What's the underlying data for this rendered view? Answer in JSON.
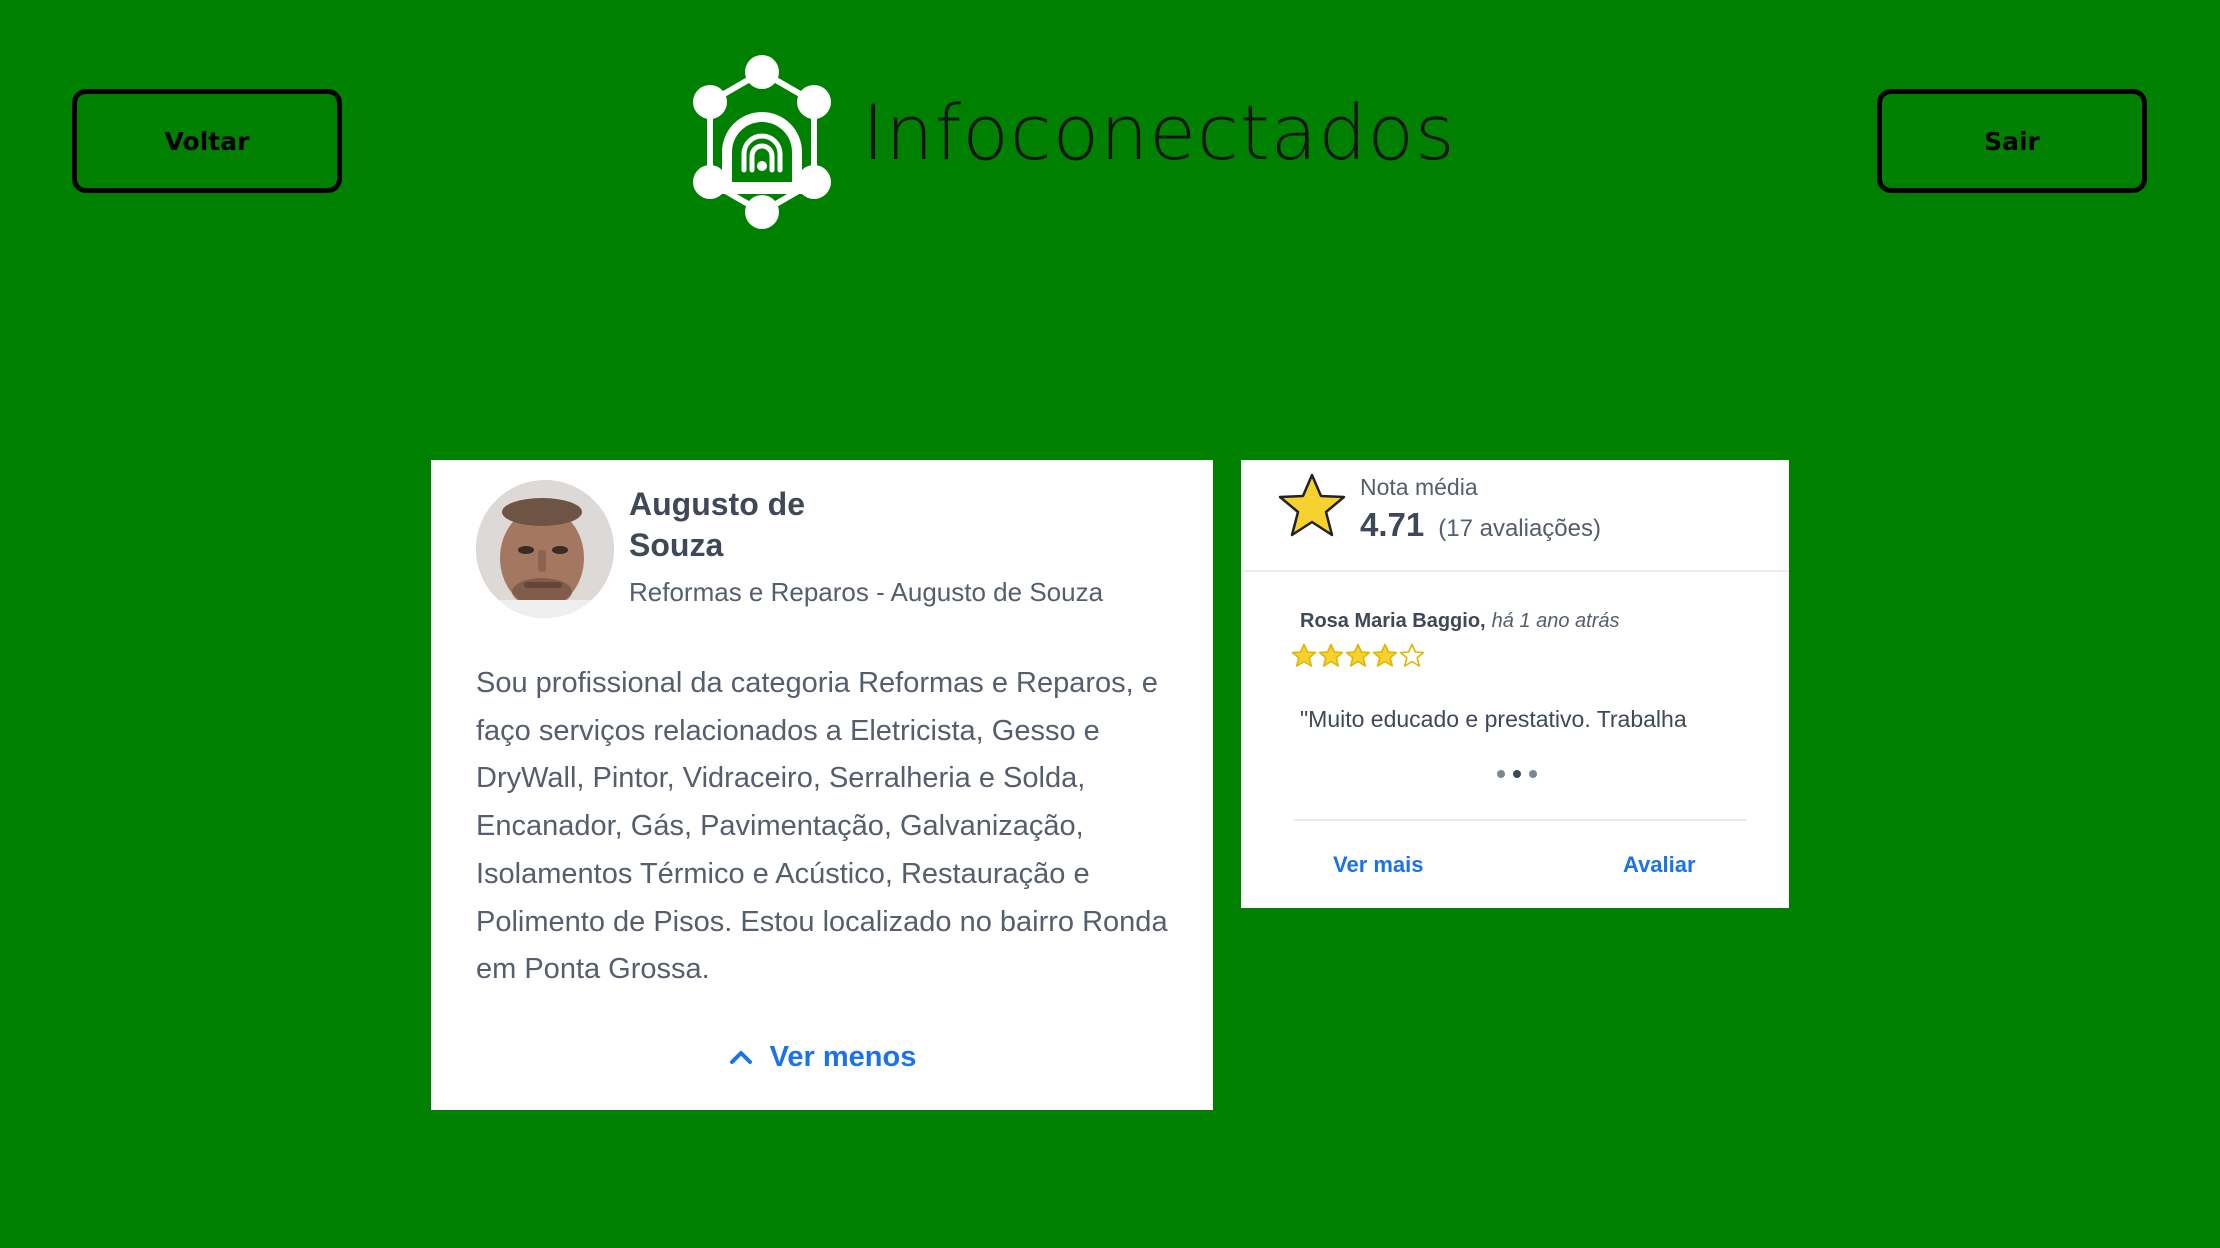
{
  "header": {
    "back_label": "Voltar",
    "exit_label": "Sair",
    "brand_name": "Infoconectados"
  },
  "profile": {
    "name": "Augusto de Souza",
    "subtitle": "Reformas e Reparos - Augusto de Souza",
    "description": "Sou profissional da categoria Reformas e Reparos, e faço serviços relacionados a Eletricista, Gesso e DryWall, Pintor, Vidraceiro, Serralheria e Solda, Encanador, Gás, Pavimentação, Galvanização, Isolamentos Térmico e Acústico, Restauração e Polimento de Pisos. Estou localizado no bairro Ronda em Ponta Grossa.",
    "toggle_label": "Ver menos"
  },
  "rating": {
    "label": "Nota média",
    "value": "4.71",
    "count_text": "(17 avaliações)",
    "review": {
      "author": "Rosa Maria Baggio,",
      "when": "há 1 ano atrás",
      "stars": 4,
      "max_stars": 5,
      "text": "\"Muito educado e prestativo. Trabalha"
    },
    "more_label": "Ver mais",
    "rate_label": "Avaliar"
  },
  "colors": {
    "background": "#008000",
    "link": "#1a73e8",
    "star": "#f7d22e"
  }
}
